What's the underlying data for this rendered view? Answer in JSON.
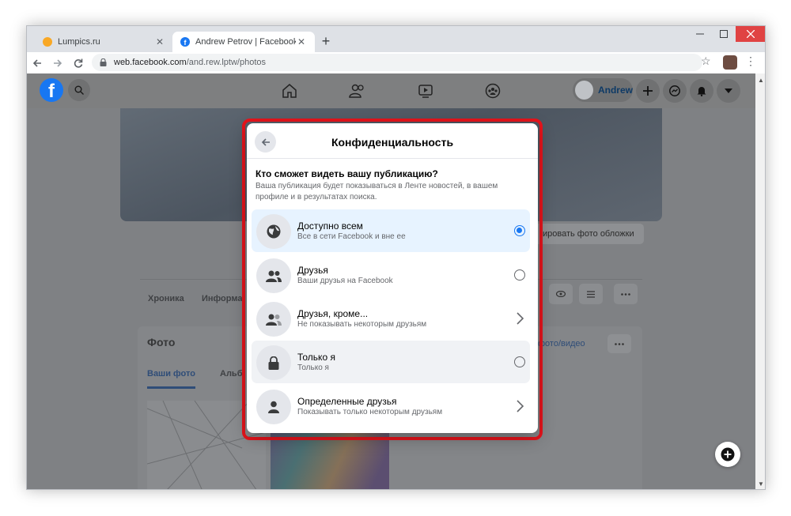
{
  "browser": {
    "tabs": [
      {
        "title": "Lumpics.ru",
        "active": false
      },
      {
        "title": "Andrew Petrov | Facebook",
        "active": true
      }
    ],
    "new_tab": "+",
    "address": {
      "domain": "web.facebook.com",
      "path": "/and.rew.lptw/photos"
    }
  },
  "header": {
    "logo": "f",
    "user_name": "Andrew"
  },
  "background_page": {
    "cover_button": "ировать фото обложки",
    "profile_tabs": [
      "Хроника",
      "Информа"
    ],
    "photos_title": "Фото",
    "photos_link": "фото/видео",
    "photo_tabs": [
      "Ваши фото",
      "Альб"
    ]
  },
  "dialog": {
    "title": "Конфиденциальность",
    "question": "Кто сможет видеть вашу публикацию?",
    "description": "Ваша публикация будет показываться в Ленте новостей, в вашем профиле и в результатах поиска.",
    "options": [
      {
        "label": "Доступно всем",
        "sub": "Все в сети Facebook и вне ее",
        "icon": "globe-icon",
        "control": "radio",
        "selected": true
      },
      {
        "label": "Друзья",
        "sub": "Ваши друзья на Facebook",
        "icon": "friends-icon",
        "control": "radio",
        "selected": false
      },
      {
        "label": "Друзья, кроме...",
        "sub": "Не показывать некоторым друзьям",
        "icon": "friends-except-icon",
        "control": "chevron",
        "selected": false
      },
      {
        "label": "Только я",
        "sub": "Только я",
        "icon": "lock-icon",
        "control": "radio",
        "selected": false
      },
      {
        "label": "Определенные друзья",
        "sub": "Показывать только некоторым друзьям",
        "icon": "person-icon",
        "control": "chevron",
        "selected": false
      }
    ]
  },
  "colors": {
    "accent": "#1877f2",
    "highlight_frame": "#e8141c",
    "selected_row": "#e7f3ff"
  }
}
